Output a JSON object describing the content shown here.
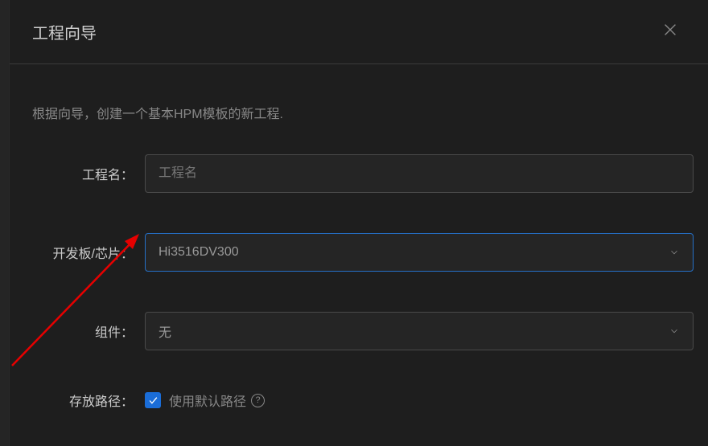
{
  "header": {
    "title": "工程向导"
  },
  "body": {
    "description": "根据向导，创建一个基本HPM模板的新工程.",
    "projectName": {
      "label": "工程名：",
      "placeholder": "工程名",
      "value": ""
    },
    "boardChip": {
      "label": "开发板/芯片：",
      "selected": "Hi3516DV300"
    },
    "components": {
      "label": "组件：",
      "selected": "无"
    },
    "storagePath": {
      "label": "存放路径：",
      "checked": true,
      "checkboxLabel": "使用默认路径",
      "helpText": "?"
    }
  }
}
